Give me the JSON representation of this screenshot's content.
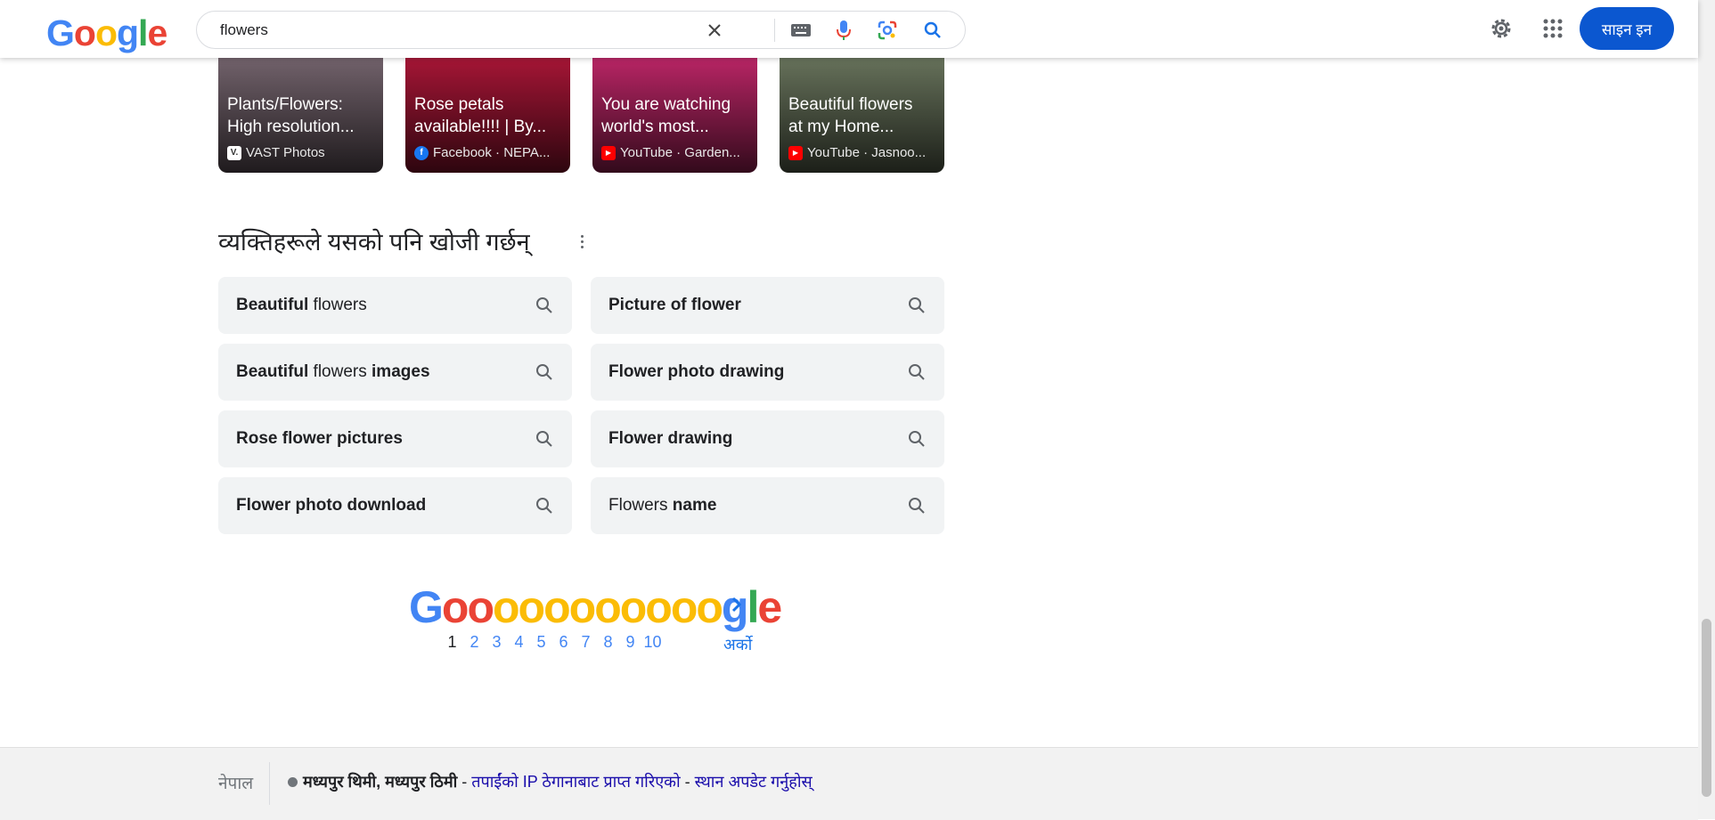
{
  "header": {
    "logo": "Google",
    "search_value": "flowers",
    "signin_label": "साइन इन"
  },
  "cards": [
    {
      "title_line1": "Plants/Flowers:",
      "title_line2": "High resolution...",
      "source": "VAST Photos",
      "source_badge": "V.",
      "bg": "#7b6a74"
    },
    {
      "title_line1": "Rose petals",
      "title_line2": "available!!!! | By...",
      "source": "Facebook · NEPA...",
      "source_badge": "f",
      "bg": "#b3173a"
    },
    {
      "title_line1": "You are watching",
      "title_line2": "world's most...",
      "source": "YouTube · Garden...",
      "source_badge": "▶",
      "bg": "#c8286d"
    },
    {
      "title_line1": "Beautiful flowers",
      "title_line2": "at my Home...",
      "source": "YouTube · Jasnoo...",
      "source_badge": "▶",
      "bg": "#6f7b62"
    }
  ],
  "pasf": {
    "title": "व्यक्तिहरूले यसको पनि खोजी गर्छन्",
    "left": [
      {
        "parts": [
          {
            "t": "Beautiful",
            "b": true
          },
          {
            "t": " flowers",
            "b": false
          }
        ]
      },
      {
        "parts": [
          {
            "t": "Beautiful",
            "b": true
          },
          {
            "t": " flowers ",
            "b": false
          },
          {
            "t": "images",
            "b": true
          }
        ]
      },
      {
        "parts": [
          {
            "t": "Rose flower pictures",
            "b": true
          }
        ]
      },
      {
        "parts": [
          {
            "t": "Flower photo download",
            "b": true
          }
        ]
      }
    ],
    "right": [
      {
        "parts": [
          {
            "t": "Picture of flower",
            "b": true
          }
        ]
      },
      {
        "parts": [
          {
            "t": "Flower photo drawing",
            "b": true
          }
        ]
      },
      {
        "parts": [
          {
            "t": "Flower drawing",
            "b": true
          }
        ]
      },
      {
        "parts": [
          {
            "t": "Flowers ",
            "b": false
          },
          {
            "t": "name",
            "b": true
          }
        ]
      }
    ]
  },
  "pagination": {
    "logo": "Gooooooooooogle",
    "pages": [
      "1",
      "2",
      "3",
      "4",
      "5",
      "6",
      "7",
      "8",
      "9",
      "10"
    ],
    "current": "1",
    "next_label": "अर्को"
  },
  "footer": {
    "country": "नेपाल",
    "location": "मध्यपुर थिमी, मध्यपुर ठिमी",
    "sep": " - ",
    "ip_text": "तपाईंको IP ठेगानाबाट प्राप्त गरिएको",
    "update_text": "स्थान अपडेट गर्नुहोस्"
  },
  "colors": {
    "google_blue": "#4285f4",
    "google_red": "#ea4335",
    "google_yellow": "#fbbc05",
    "google_green": "#34a853",
    "signin_bg": "#0b57d0"
  }
}
